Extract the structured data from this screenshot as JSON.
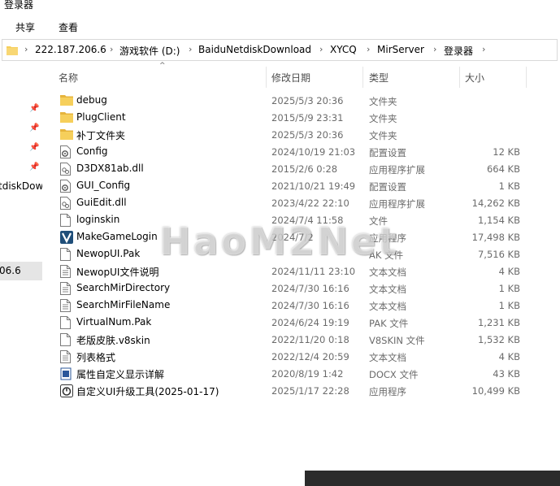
{
  "window": {
    "title": "登录器"
  },
  "ribbon": {
    "tabs": [
      "共享",
      "查看"
    ]
  },
  "address": {
    "crumbs": [
      "222.187.206.6",
      "游戏软件 (D:)",
      "BaiduNetdiskDownload",
      "XYCQ",
      "MirServer",
      "登录器"
    ]
  },
  "nav": {
    "partial_items": [
      "tdiskDow",
      "06.6"
    ]
  },
  "columns": {
    "name": "名称",
    "date": "修改日期",
    "type": "类型",
    "size": "大小"
  },
  "files": [
    {
      "icon": "folder-icon",
      "name": "debug",
      "date": "2025/5/3 20:36",
      "type": "文件夹",
      "size": ""
    },
    {
      "icon": "folder-icon",
      "name": "PlugClient",
      "date": "2015/5/9 23:31",
      "type": "文件夹",
      "size": ""
    },
    {
      "icon": "folder-icon",
      "name": "补丁文件夹",
      "date": "2025/5/3 20:36",
      "type": "文件夹",
      "size": ""
    },
    {
      "icon": "config-file-icon",
      "name": "Config",
      "date": "2024/10/19 21:03",
      "type": "配置设置",
      "size": "12 KB"
    },
    {
      "icon": "dll-file-icon",
      "name": "D3DX81ab.dll",
      "date": "2015/2/6 0:28",
      "type": "应用程序扩展",
      "size": "664 KB"
    },
    {
      "icon": "config-file-icon",
      "name": "GUI_Config",
      "date": "2021/10/21 19:49",
      "type": "配置设置",
      "size": "1 KB"
    },
    {
      "icon": "dll-file-icon",
      "name": "GuiEdit.dll",
      "date": "2023/4/22 22:10",
      "type": "应用程序扩展",
      "size": "14,262 KB"
    },
    {
      "icon": "blank-file-icon",
      "name": "loginskin",
      "date": "2024/7/4 11:58",
      "type": "文件",
      "size": "1,154 KB"
    },
    {
      "icon": "app-v-icon",
      "name": "MakeGameLogin",
      "date": "2024/7/2",
      "type": "应用程序",
      "size": "17,498 KB"
    },
    {
      "icon": "blank-file-icon",
      "name": "NewopUI.Pak",
      "date": "",
      "type": "AK 文件",
      "size": "7,516 KB"
    },
    {
      "icon": "text-file-icon",
      "name": "NewopUI文件说明",
      "date": "2024/11/11 23:10",
      "type": "文本文档",
      "size": "4 KB"
    },
    {
      "icon": "text-file-icon",
      "name": "SearchMirDirectory",
      "date": "2024/7/30 16:16",
      "type": "文本文档",
      "size": "1 KB"
    },
    {
      "icon": "text-file-icon",
      "name": "SearchMirFileName",
      "date": "2024/7/30 16:16",
      "type": "文本文档",
      "size": "1 KB"
    },
    {
      "icon": "blank-file-icon",
      "name": "VirtualNum.Pak",
      "date": "2024/6/24 19:19",
      "type": "PAK 文件",
      "size": "1,231 KB"
    },
    {
      "icon": "blank-file-icon",
      "name": "老版皮肤.v8skin",
      "date": "2022/11/20 0:18",
      "type": "V8SKIN 文件",
      "size": "1,532 KB"
    },
    {
      "icon": "text-file-icon",
      "name": "列表格式",
      "date": "2022/12/4 20:59",
      "type": "文本文档",
      "size": "4 KB"
    },
    {
      "icon": "docx-file-icon",
      "name": "属性自定义显示详解",
      "date": "2020/8/19 1:42",
      "type": "DOCX 文件",
      "size": "43 KB"
    },
    {
      "icon": "app-upgrade-icon",
      "name": "自定义UI升级工具(2025-01-17)",
      "date": "2025/1/17 22:28",
      "type": "应用程序",
      "size": "10,499 KB"
    }
  ],
  "watermark": {
    "text": "HaoM2Net"
  },
  "colors": {
    "folder": "#f6cf5b",
    "folder_dark": "#e6b43c",
    "selection": "#e5e5e5",
    "app_v": "#1f4e79"
  }
}
